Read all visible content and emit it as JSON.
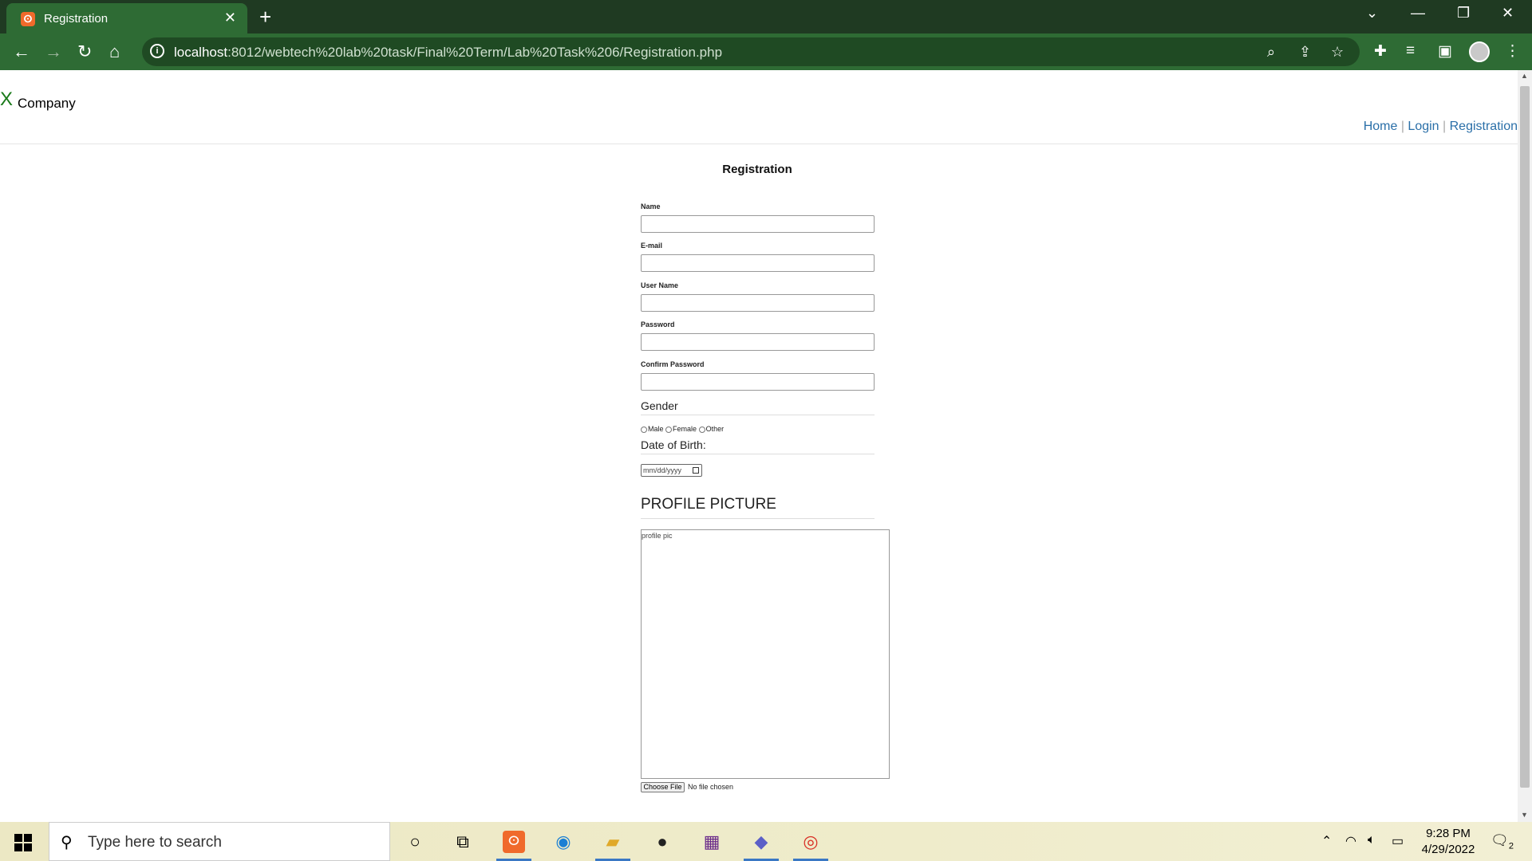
{
  "browser": {
    "tab_title": "Registration",
    "url_host": "localhost",
    "url_rest": ":8012/webtech%20lab%20task/Final%20Term/Lab%20Task%206/Registration.php"
  },
  "header": {
    "logo_mark": "X",
    "logo_text": "Company",
    "nav": {
      "home": "Home",
      "login": "Login",
      "registration": "Registration",
      "sep": " | "
    }
  },
  "form": {
    "title": "Registration",
    "fields": {
      "name": {
        "label": "Name",
        "value": ""
      },
      "email": {
        "label": "E-mail",
        "value": ""
      },
      "username": {
        "label": "User Name",
        "value": ""
      },
      "password": {
        "label": "Password",
        "value": ""
      },
      "confirm_password": {
        "label": "Confirm Password",
        "value": ""
      }
    },
    "gender": {
      "legend": "Gender",
      "options": [
        "Male",
        "Female",
        "Other"
      ]
    },
    "dob": {
      "legend": "Date of Birth:",
      "placeholder": "mm/dd/yyyy"
    },
    "profile_picture": {
      "legend": "PROFILE PICTURE",
      "image_alt": "profile pic",
      "choose_file_label": "Choose File",
      "file_status": "No file chosen"
    }
  },
  "taskbar": {
    "search_placeholder": "Type here to search",
    "time": "9:28 PM",
    "date": "4/29/2022",
    "notification_count": "2"
  }
}
